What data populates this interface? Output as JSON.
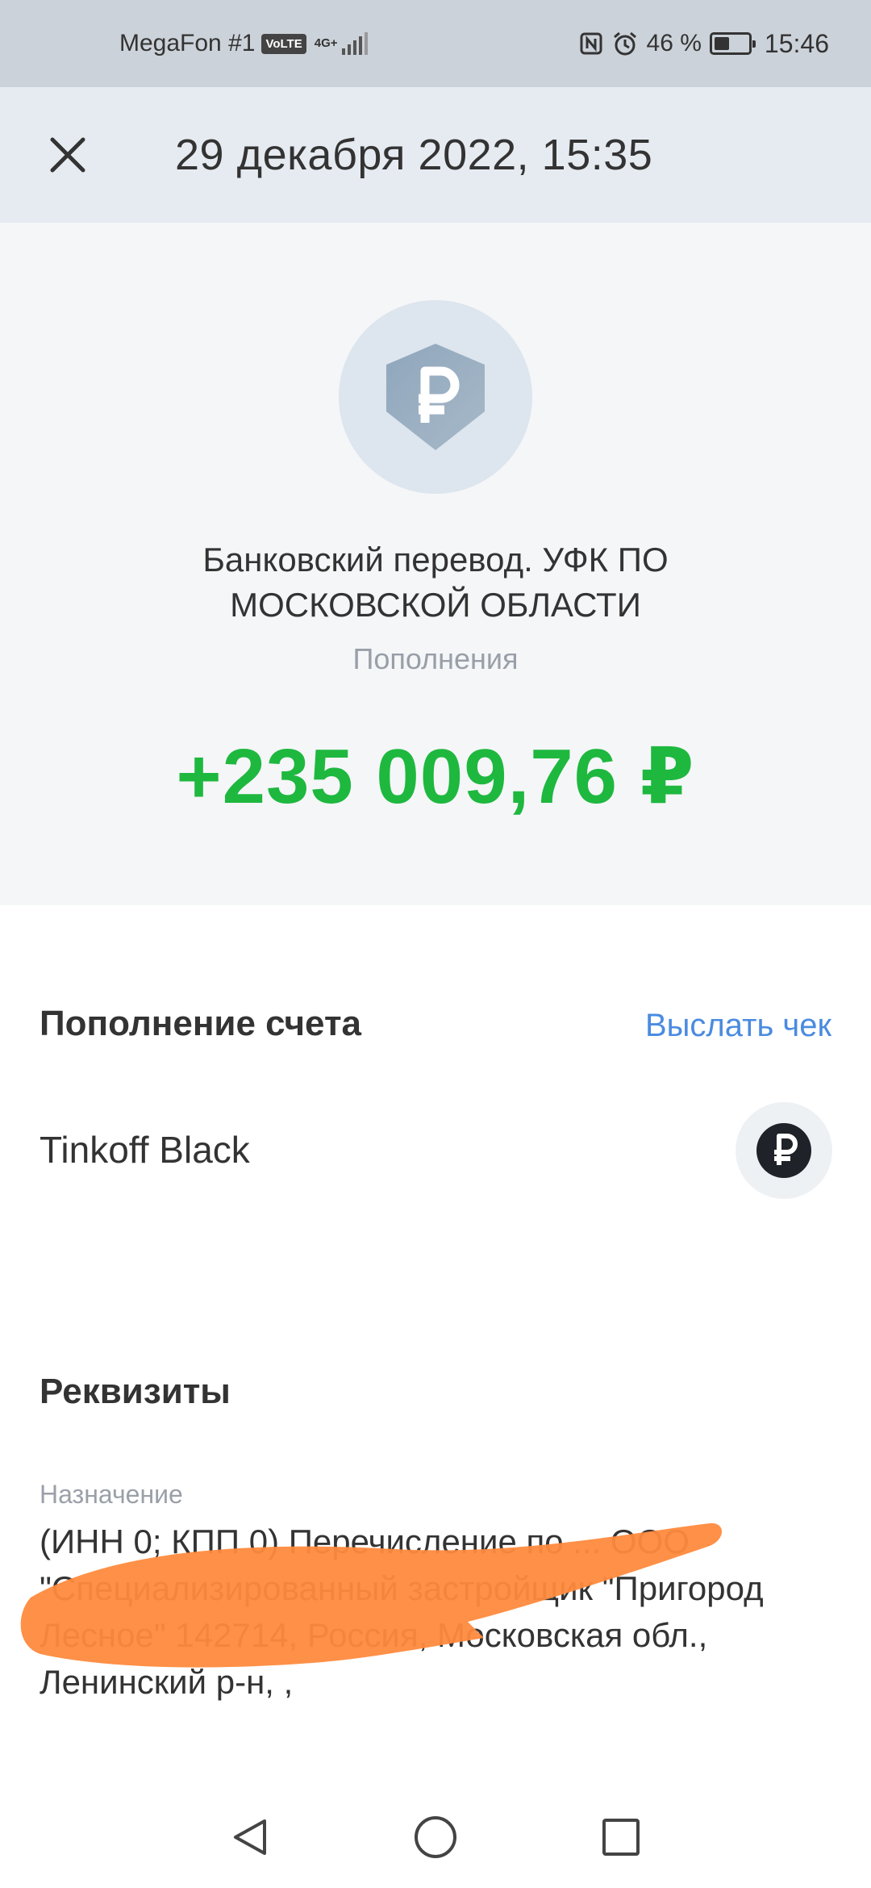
{
  "status_bar": {
    "carrier": "MegaFon #1",
    "volte": "VoLTE",
    "network": "4G+",
    "battery": "46 %",
    "battery_level": 0.46,
    "time": "15:46"
  },
  "header": {
    "title": "29 декабря 2022, 15:35"
  },
  "summary": {
    "icon": "ruble-shield-icon",
    "counterparty": "Банковский перевод. УФК ПО МОСКОВСКОЙ ОБЛАСТИ",
    "category": "Пополнения",
    "amount": "+235 009,76 ₽"
  },
  "account_section": {
    "title": "Пополнение счета",
    "send_receipt": "Выслать чек",
    "account_name": "Tinkoff Black",
    "account_icon": "ruble-icon"
  },
  "details_section": {
    "title": "Реквизиты",
    "purpose_label": "Назначение",
    "purpose_value": "(ИНН 0; КПП 0) Перечисление по ... ООО \"Специализированный застройщик \"Пригород Лесное\" 142714, Россия, Московская обл., Ленинский р-н, ,"
  },
  "colors": {
    "amount_green": "#1eb83f",
    "link_blue": "#4a8be0",
    "header_bg": "#e6ebf1",
    "redaction_orange": "#ff8a3d"
  }
}
